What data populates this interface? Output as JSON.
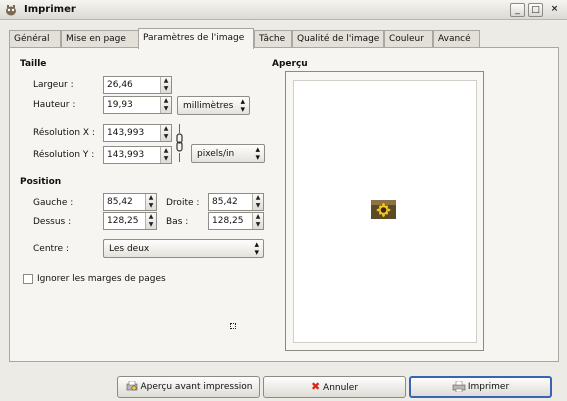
{
  "window": {
    "title": "Imprimer",
    "buttons": {
      "minimize": "_",
      "maximize": "□",
      "close": "×"
    }
  },
  "tabs": [
    {
      "label": "Général"
    },
    {
      "label": "Mise en page"
    },
    {
      "label": "Paramètres de l'image"
    },
    {
      "label": "Tâche"
    },
    {
      "label": "Qualité de l'image"
    },
    {
      "label": "Couleur"
    },
    {
      "label": "Avancé"
    }
  ],
  "taille": {
    "heading": "Taille",
    "largeur": {
      "label": "Largeur :",
      "value": "26,46"
    },
    "hauteur": {
      "label": "Hauteur :",
      "value": "19,93"
    },
    "unit_size": "millimètres",
    "resolution_x": {
      "label": "Résolution X :",
      "value": "143,993"
    },
    "resolution_y": {
      "label": "Résolution Y :",
      "value": "143,993"
    },
    "unit_res": "pixels/in"
  },
  "position": {
    "heading": "Position",
    "gauche": {
      "label": "Gauche :",
      "value": "85,42"
    },
    "droite": {
      "label": "Droite :",
      "value": "85,42"
    },
    "dessus": {
      "label": "Dessus :",
      "value": "128,25"
    },
    "bas": {
      "label": "Bas :",
      "value": "128,25"
    },
    "centre": {
      "label": "Centre :",
      "value": "Les deux"
    }
  },
  "ignore_margins": {
    "label": "Ignorer les marges de pages",
    "checked": false
  },
  "preview": {
    "heading": "Aperçu"
  },
  "footer": {
    "preview_button": "Aperçu avant impression",
    "cancel_button": "Annuler",
    "print_button": "Imprimer"
  },
  "colors": {
    "accent": "#3a63b3",
    "cancel_red": "#d9261c"
  }
}
